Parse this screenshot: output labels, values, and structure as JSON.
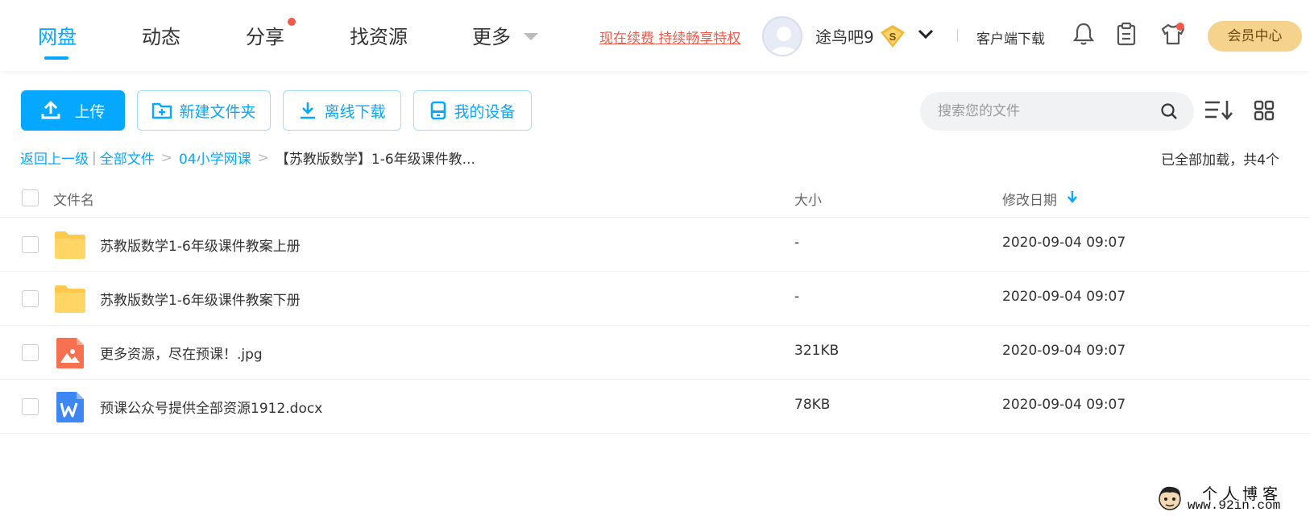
{
  "nav": {
    "tabs": [
      {
        "label": "网盘",
        "active": true
      },
      {
        "label": "动态"
      },
      {
        "label": "分享",
        "badge_dot": true
      },
      {
        "label": "找资源"
      },
      {
        "label": "更多",
        "has_dropdown": true
      }
    ],
    "promo_text": "现在续费 持续畅享特权",
    "user": {
      "name": "途鸟吧9",
      "vip_badge": "S"
    },
    "client_download": "客户端下载",
    "icons": [
      "bell-icon",
      "clipboard-icon",
      "shirt-icon"
    ],
    "vip_center": "会员中心"
  },
  "toolbar": {
    "upload": "上传",
    "new_folder": "新建文件夹",
    "offline_download": "离线下载",
    "my_devices": "我的设备",
    "search_placeholder": "搜索您的文件"
  },
  "breadcrumb": {
    "back": "返回上一级",
    "items": [
      "全部文件",
      "04小学网课"
    ],
    "current": "【苏教版数学】1-6年级课件教..."
  },
  "load_status": "已全部加载，共4个",
  "table": {
    "headers": {
      "name": "文件名",
      "size": "大小",
      "modified": "修改日期"
    },
    "sort_indicator": "descending",
    "rows": [
      {
        "name": "苏教版数学1-6年级课件教案上册",
        "size": "-",
        "date": "2020-09-04 09:07",
        "type": "folder"
      },
      {
        "name": "苏教版数学1-6年级课件教案下册",
        "size": "-",
        "date": "2020-09-04 09:07",
        "type": "folder"
      },
      {
        "name": "更多资源，尽在预课！.jpg",
        "size": "321KB",
        "date": "2020-09-04 09:07",
        "type": "image"
      },
      {
        "name": "预课公众号提供全部资源1912.docx",
        "size": "78KB",
        "date": "2020-09-04 09:07",
        "type": "word"
      }
    ]
  },
  "watermark": {
    "title": "个人博客",
    "url": "www.92in.com"
  },
  "colors": {
    "accent": "#06a7ff",
    "promo": "#f25a4a",
    "vip_button": "#f5d38c",
    "folder": "#ffc94d",
    "image_file": "#f7704f",
    "word_file": "#3f86f5"
  }
}
